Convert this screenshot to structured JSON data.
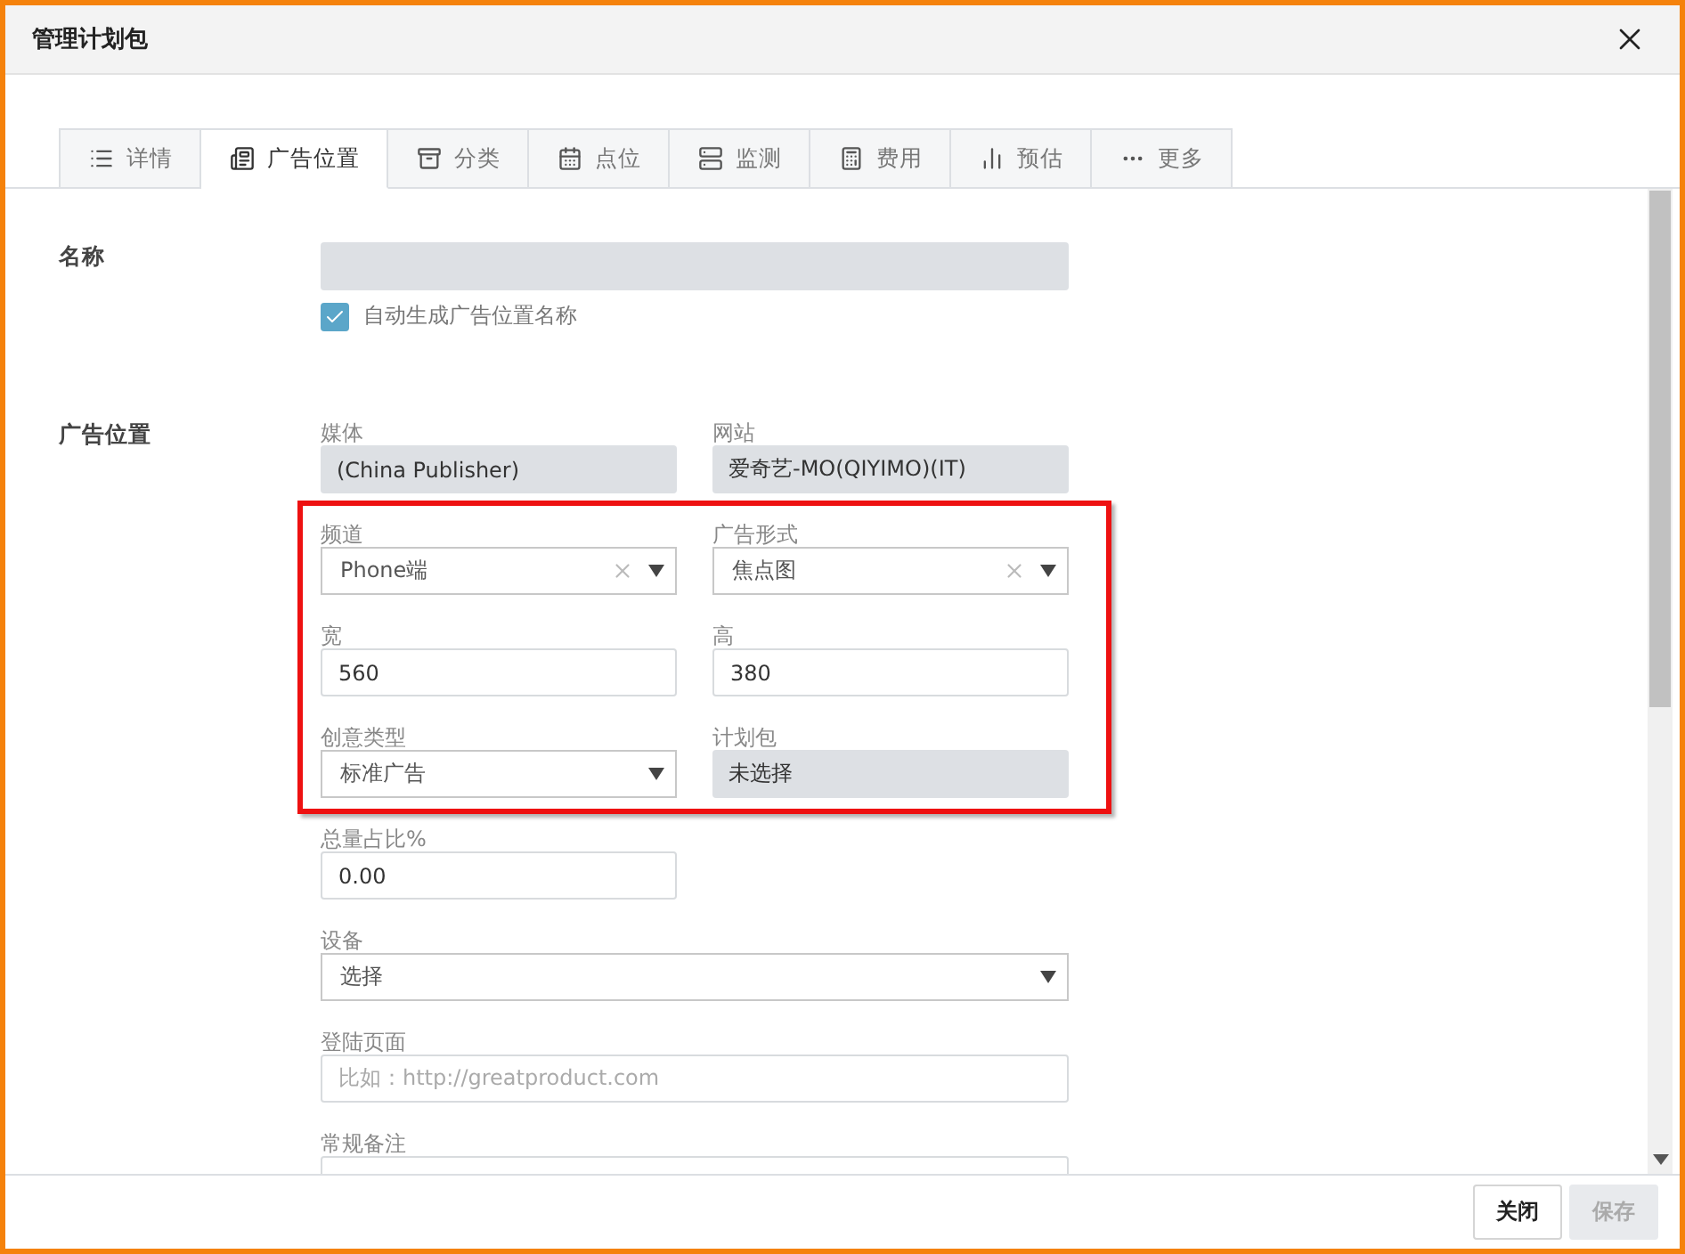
{
  "dialog": {
    "title": "管理计划包"
  },
  "tabs": [
    {
      "label": "详情",
      "selected": false
    },
    {
      "label": "广告位置",
      "selected": true
    },
    {
      "label": "分类",
      "selected": false
    },
    {
      "label": "点位",
      "selected": false
    },
    {
      "label": "监测",
      "selected": false
    },
    {
      "label": "费用",
      "selected": false
    },
    {
      "label": "预估",
      "selected": false
    },
    {
      "label": "更多",
      "selected": false
    }
  ],
  "name_section": {
    "label": "名称",
    "checkbox": {
      "label": "自动生成广告位置名称",
      "checked": true
    }
  },
  "placement_section": {
    "label": "广告位置",
    "rows": [
      [
        {
          "label": "媒体",
          "kind": "readonly",
          "value": "(China Publisher)"
        },
        {
          "label": "网站",
          "kind": "readonly",
          "value": "爱奇艺-MO(QIYIMO)(IT)"
        }
      ],
      [
        {
          "label": "频道",
          "kind": "select",
          "value": "Phone端",
          "clearable": true
        },
        {
          "label": "广告形式",
          "kind": "select",
          "value": "焦点图",
          "clearable": true
        }
      ],
      [
        {
          "label": "宽",
          "kind": "input",
          "value": "560"
        },
        {
          "label": "高",
          "kind": "input",
          "value": "380"
        }
      ],
      [
        {
          "label": "创意类型",
          "kind": "select",
          "value": "标准广告",
          "clearable": false
        },
        {
          "label": "计划包",
          "kind": "readonly",
          "value": "未选择"
        }
      ],
      [
        {
          "label": "总量占比%",
          "kind": "input",
          "value": "0.00"
        }
      ],
      [
        {
          "label": "设备",
          "kind": "select",
          "value": "选择",
          "clearable": false
        }
      ],
      [
        {
          "label": "登陆页面",
          "kind": "input",
          "placeholder": "比如：http://greatproduct.com"
        }
      ],
      [
        {
          "label": "常规备注",
          "kind": "textarea"
        }
      ]
    ]
  },
  "buttons": [
    {
      "label": "关闭",
      "disabled": false
    },
    {
      "label": "保存",
      "disabled": true
    }
  ]
}
